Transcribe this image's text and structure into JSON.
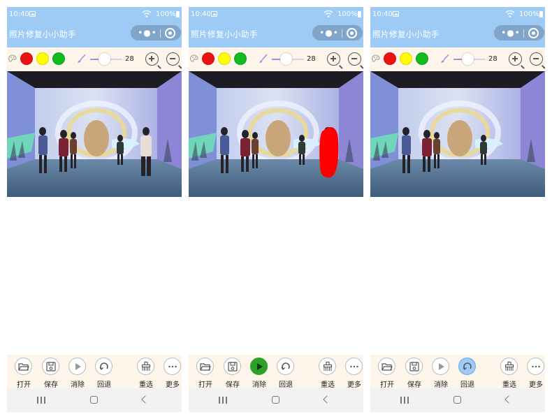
{
  "screens": [
    {
      "status": {
        "time": "10:40",
        "battery": "100%"
      },
      "title": "照片修复小小助手",
      "toolbar": {
        "colors": [
          "#ee1111",
          "#ffff00",
          "#11bb22"
        ],
        "brush_size": "28",
        "brush_level": 0.45
      },
      "bottom": {
        "open": "打开",
        "save": "保存",
        "erase": "消除",
        "undo": "回退",
        "reselect": "重选",
        "more": "更多"
      },
      "state": {
        "active_tool": "none",
        "mask": "none",
        "person_removed": false
      }
    },
    {
      "status": {
        "time": "10:40",
        "battery": "100%"
      },
      "title": "照片修复小小助手",
      "toolbar": {
        "colors": [
          "#ee1111",
          "#ffff00",
          "#11bb22"
        ],
        "brush_size": "28",
        "brush_level": 0.45
      },
      "bottom": {
        "open": "打开",
        "save": "保存",
        "erase": "消除",
        "undo": "回退",
        "reselect": "重选",
        "more": "更多"
      },
      "state": {
        "active_tool": "erase",
        "mask": "red",
        "person_removed": false
      }
    },
    {
      "status": {
        "time": "10:40",
        "battery": "100%"
      },
      "title": "照片修复小小助手",
      "toolbar": {
        "colors": [
          "#ee1111",
          "#ffff00",
          "#11bb22"
        ],
        "brush_size": "28",
        "brush_level": 0.45
      },
      "bottom": {
        "open": "打开",
        "save": "保存",
        "erase": "消除",
        "undo": "回退",
        "reselect": "重选",
        "more": "更多"
      },
      "state": {
        "active_tool": "undo",
        "mask": "none",
        "person_removed": true
      }
    }
  ],
  "icons": {
    "open": "folder-open-icon",
    "save": "save-disk-icon",
    "erase": "play-icon",
    "undo": "undo-circle-icon",
    "reselect": "broom-icon",
    "more": "more-dots-icon"
  },
  "colors": {
    "header": "#9ecbf5",
    "toolbar_bg": "#fdf5ea",
    "active_green": "#2aa22a",
    "active_blue": "#9ecbf5",
    "mask": "#ff0000"
  }
}
